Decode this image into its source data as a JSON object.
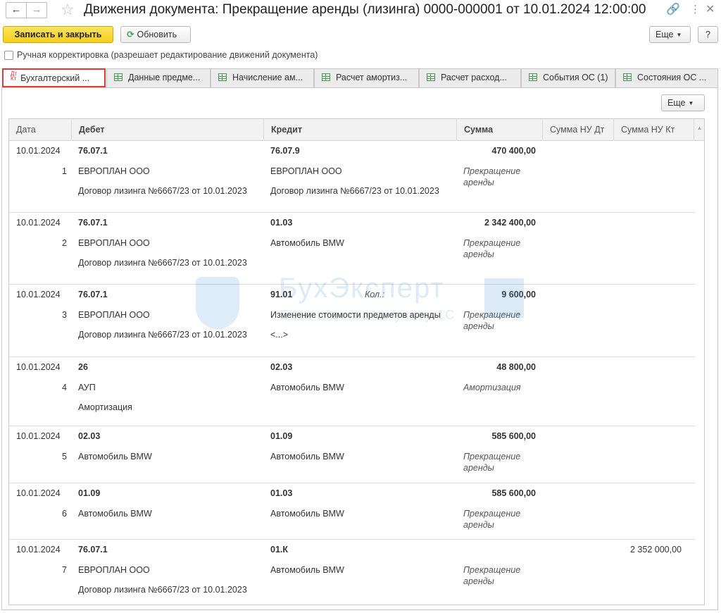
{
  "window": {
    "title": "Движения документа: Прекращение аренды (лизинга) 0000-000001 от 10.01.2024 12:00:00"
  },
  "toolbar": {
    "save_close_label": "Записать и закрыть",
    "refresh_label": "Обновить",
    "more_label": "Еще",
    "help_label": "?"
  },
  "manual_edit": {
    "label": "Ручная корректировка (разрешает редактирование движений документа)",
    "checked": false
  },
  "tabs": [
    {
      "label": "Бухгалтерский ...",
      "icon": "dt-kt-icon",
      "active": true
    },
    {
      "label": "Данные предме...",
      "icon": "table-icon",
      "active": false
    },
    {
      "label": "Начисление ам...",
      "icon": "table-icon",
      "active": false
    },
    {
      "label": "Расчет амортиз...",
      "icon": "table-icon",
      "active": false
    },
    {
      "label": "Расчет расход...",
      "icon": "table-icon",
      "active": false
    },
    {
      "label": "События ОС (1)",
      "icon": "table-icon",
      "active": false
    },
    {
      "label": "Состояния ОС ...",
      "icon": "table-icon",
      "active": false
    }
  ],
  "panel": {
    "more_label": "Еще"
  },
  "grid": {
    "columns": [
      "Дата",
      "Дебет",
      "Кредит",
      "Сумма",
      "Сумма НУ Дт",
      "Сумма НУ Кт"
    ],
    "rows": [
      {
        "date": "10.01.2024",
        "num": "1",
        "debit_account": "76.07.1",
        "debit_sub1": "ЕВРОПЛАН ООО",
        "debit_sub2": "Договор лизинга №6667/23 от 10.01.2023",
        "credit_account": "76.07.9",
        "credit_qty": "",
        "credit_sub1": "ЕВРОПЛАН ООО",
        "credit_sub2": "Договор лизинга №6667/23 от 10.01.2023",
        "amount": "470 400,00",
        "content": "Прекращение аренды",
        "nu_kt": ""
      },
      {
        "date": "10.01.2024",
        "num": "2",
        "debit_account": "76.07.1",
        "debit_sub1": "ЕВРОПЛАН ООО",
        "debit_sub2": "Договор лизинга №6667/23 от 10.01.2023",
        "credit_account": "01.03",
        "credit_qty": "",
        "credit_sub1": "Автомобиль BMW",
        "credit_sub2": "",
        "amount": "2 342 400,00",
        "content": "Прекращение аренды",
        "nu_kt": ""
      },
      {
        "date": "10.01.2024",
        "num": "3",
        "debit_account": "76.07.1",
        "debit_sub1": "ЕВРОПЛАН ООО",
        "debit_sub2": "Договор лизинга №6667/23 от 10.01.2023",
        "credit_account": "91.01",
        "credit_qty": "Кол.:",
        "credit_sub1": "Изменение стоимости предметов аренды",
        "credit_sub2": "<...>",
        "amount": "9 600,00",
        "content": "Прекращение аренды",
        "nu_kt": ""
      },
      {
        "date": "10.01.2024",
        "num": "4",
        "debit_account": "26",
        "debit_sub1": "АУП",
        "debit_sub2": "Амортизация",
        "credit_account": "02.03",
        "credit_qty": "",
        "credit_sub1": "Автомобиль BMW",
        "credit_sub2": "",
        "amount": "48 800,00",
        "content": "Амортизация",
        "nu_kt": ""
      },
      {
        "date": "10.01.2024",
        "num": "5",
        "debit_account": "02.03",
        "debit_sub1": "Автомобиль BMW",
        "debit_sub2": "",
        "credit_account": "01.09",
        "credit_qty": "",
        "credit_sub1": "Автомобиль BMW",
        "credit_sub2": "",
        "amount": "585 600,00",
        "content": "Прекращение аренды",
        "nu_kt": ""
      },
      {
        "date": "10.01.2024",
        "num": "6",
        "debit_account": "01.09",
        "debit_sub1": "Автомобиль BMW",
        "debit_sub2": "",
        "credit_account": "01.03",
        "credit_qty": "",
        "credit_sub1": "Автомобиль BMW",
        "credit_sub2": "",
        "amount": "585 600,00",
        "content": "Прекращение аренды",
        "nu_kt": ""
      },
      {
        "date": "10.01.2024",
        "num": "7",
        "debit_account": "76.07.1",
        "debit_sub1": "ЕВРОПЛАН ООО",
        "debit_sub2": "Договор лизинга №6667/23 от 10.01.2023",
        "credit_account": "01.К",
        "credit_qty": "",
        "credit_sub1": "Автомобиль BMW",
        "credit_sub2": "",
        "amount": "",
        "content": "Прекращение аренды",
        "nu_kt": "2 352 000,00"
      }
    ]
  },
  "watermark": {
    "brand": "БухЭксперт",
    "tagline": "База ответов по учёту 1С",
    "digit": "8"
  }
}
